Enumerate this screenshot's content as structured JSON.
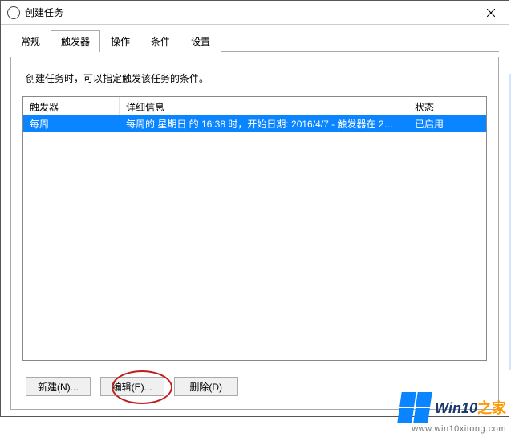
{
  "window": {
    "title": "创建任务"
  },
  "tabs": [
    {
      "label": "常规"
    },
    {
      "label": "触发器"
    },
    {
      "label": "操作"
    },
    {
      "label": "条件"
    },
    {
      "label": "设置"
    }
  ],
  "active_tab_index": 1,
  "trigger_panel": {
    "instruction": "创建任务时，可以指定触发该任务的条件。",
    "columns": {
      "trigger": "触发器",
      "detail": "详细信息",
      "status": "状态"
    },
    "rows": [
      {
        "trigger": "每周",
        "detail": "每周的 星期日 的 16:38 时，开始日期: 2016/4/7 - 触发器在 2…",
        "status": "已启用",
        "selected": true
      }
    ],
    "buttons": {
      "new": "新建(N)...",
      "edit": "编辑(E)...",
      "delete": "删除(D)"
    }
  },
  "watermark": {
    "brand_prefix": "Win10",
    "brand_suffix": "之家",
    "url": "www.win10xitong.com"
  }
}
